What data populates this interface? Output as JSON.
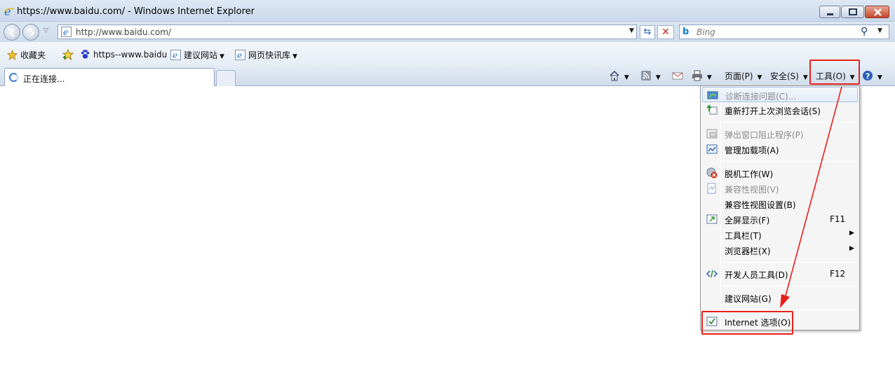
{
  "window": {
    "title": "https://www.baidu.com/ - Windows Internet Explorer"
  },
  "address_bar": {
    "url": "http://www.baidu.com/"
  },
  "search": {
    "placeholder": "Bing"
  },
  "favorites_bar": {
    "favorites_label": "收藏夹",
    "items": [
      {
        "label": "https--www.baidu"
      },
      {
        "label": "建议网站"
      },
      {
        "label": "网页快讯库"
      }
    ]
  },
  "tabs": {
    "active_title": "正在连接..."
  },
  "command_bar": {
    "page_label": "页面(P)",
    "safety_label": "安全(S)",
    "tools_label": "工具(O)"
  },
  "tools_menu": {
    "items": [
      {
        "label": "诊断连接问题(C)...",
        "enabled": false,
        "icon": "diagnose-icon"
      },
      {
        "label": "重新打开上次浏览会话(S)",
        "enabled": true,
        "icon": "reopen-session-icon"
      },
      {
        "label": "弹出窗口阻止程序(P)",
        "enabled": false,
        "icon": "popup-blocker-icon"
      },
      {
        "label": "管理加载项(A)",
        "enabled": true,
        "icon": "addons-icon"
      },
      {
        "label": "脱机工作(W)",
        "enabled": true,
        "icon": "offline-icon"
      },
      {
        "label": "兼容性视图(V)",
        "enabled": false,
        "icon": "compat-view-icon"
      },
      {
        "label": "兼容性视图设置(B)",
        "enabled": true
      },
      {
        "label": "全屏显示(F)",
        "enabled": true,
        "shortcut": "F11",
        "icon": "fullscreen-icon"
      },
      {
        "label": "工具栏(T)",
        "enabled": true,
        "submenu": true
      },
      {
        "label": "浏览器栏(X)",
        "enabled": true,
        "submenu": true
      },
      {
        "label": "开发人员工具(D)",
        "enabled": true,
        "shortcut": "F12",
        "icon": "dev-tools-icon"
      },
      {
        "label": "建议网站(G)",
        "enabled": true
      },
      {
        "label": "Internet 选项(O)",
        "enabled": true,
        "icon": "internet-options-icon"
      }
    ]
  },
  "colors": {
    "highlight_red": "#e8201c",
    "menu_bg": "#f5f5f5",
    "disabled_text": "#8d8d8d"
  }
}
